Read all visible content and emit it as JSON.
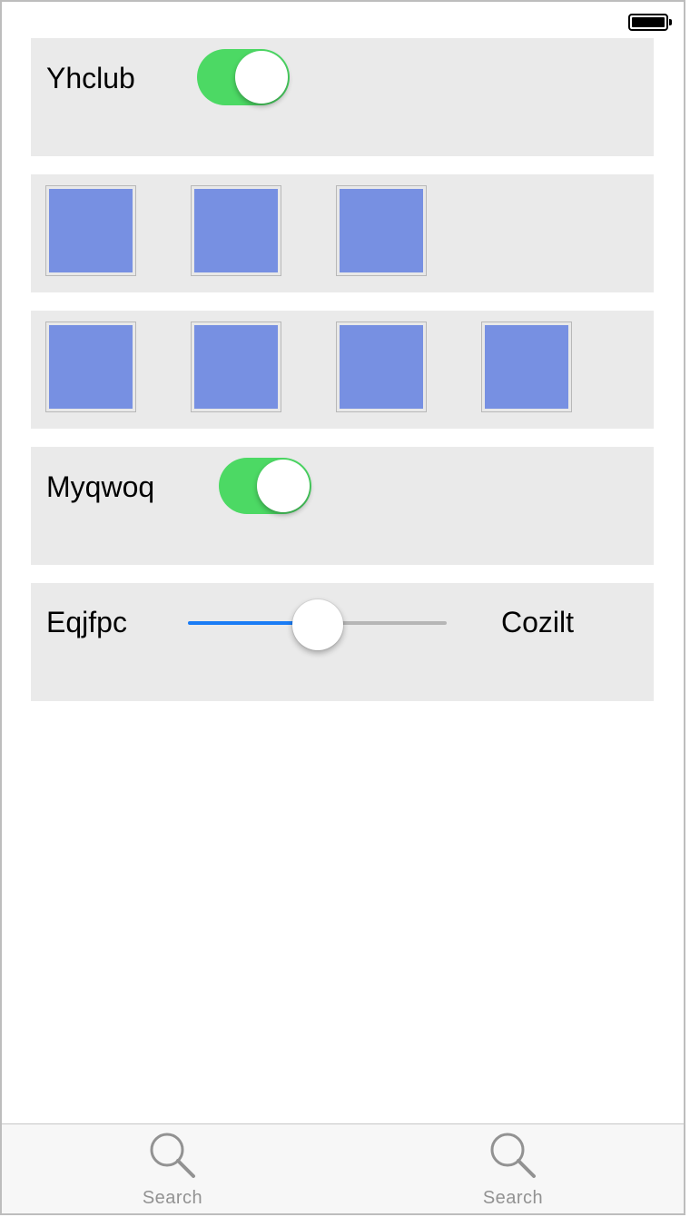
{
  "status_bar": {
    "battery_icon": "battery-full-icon"
  },
  "rows": [
    {
      "type": "switch",
      "label": "Yhclub",
      "on": true
    },
    {
      "type": "tiles",
      "count": 3
    },
    {
      "type": "tiles",
      "count": 4
    },
    {
      "type": "switch",
      "label": "Myqwoq",
      "on": true
    },
    {
      "type": "slider",
      "label": "Eqjfpc",
      "trailing_label": "Cozilt",
      "value": 0.5
    }
  ],
  "tab_bar": {
    "items": [
      {
        "label": "Search",
        "icon": "search-icon"
      },
      {
        "label": "Search",
        "icon": "search-icon"
      }
    ]
  },
  "colors": {
    "switch_on": "#4cd964",
    "tile": "#7790e2",
    "panel": "#eaeaea",
    "slider_min": "#1a7cf5",
    "slider_max": "#b6b6b6",
    "tab_label": "#929292"
  }
}
